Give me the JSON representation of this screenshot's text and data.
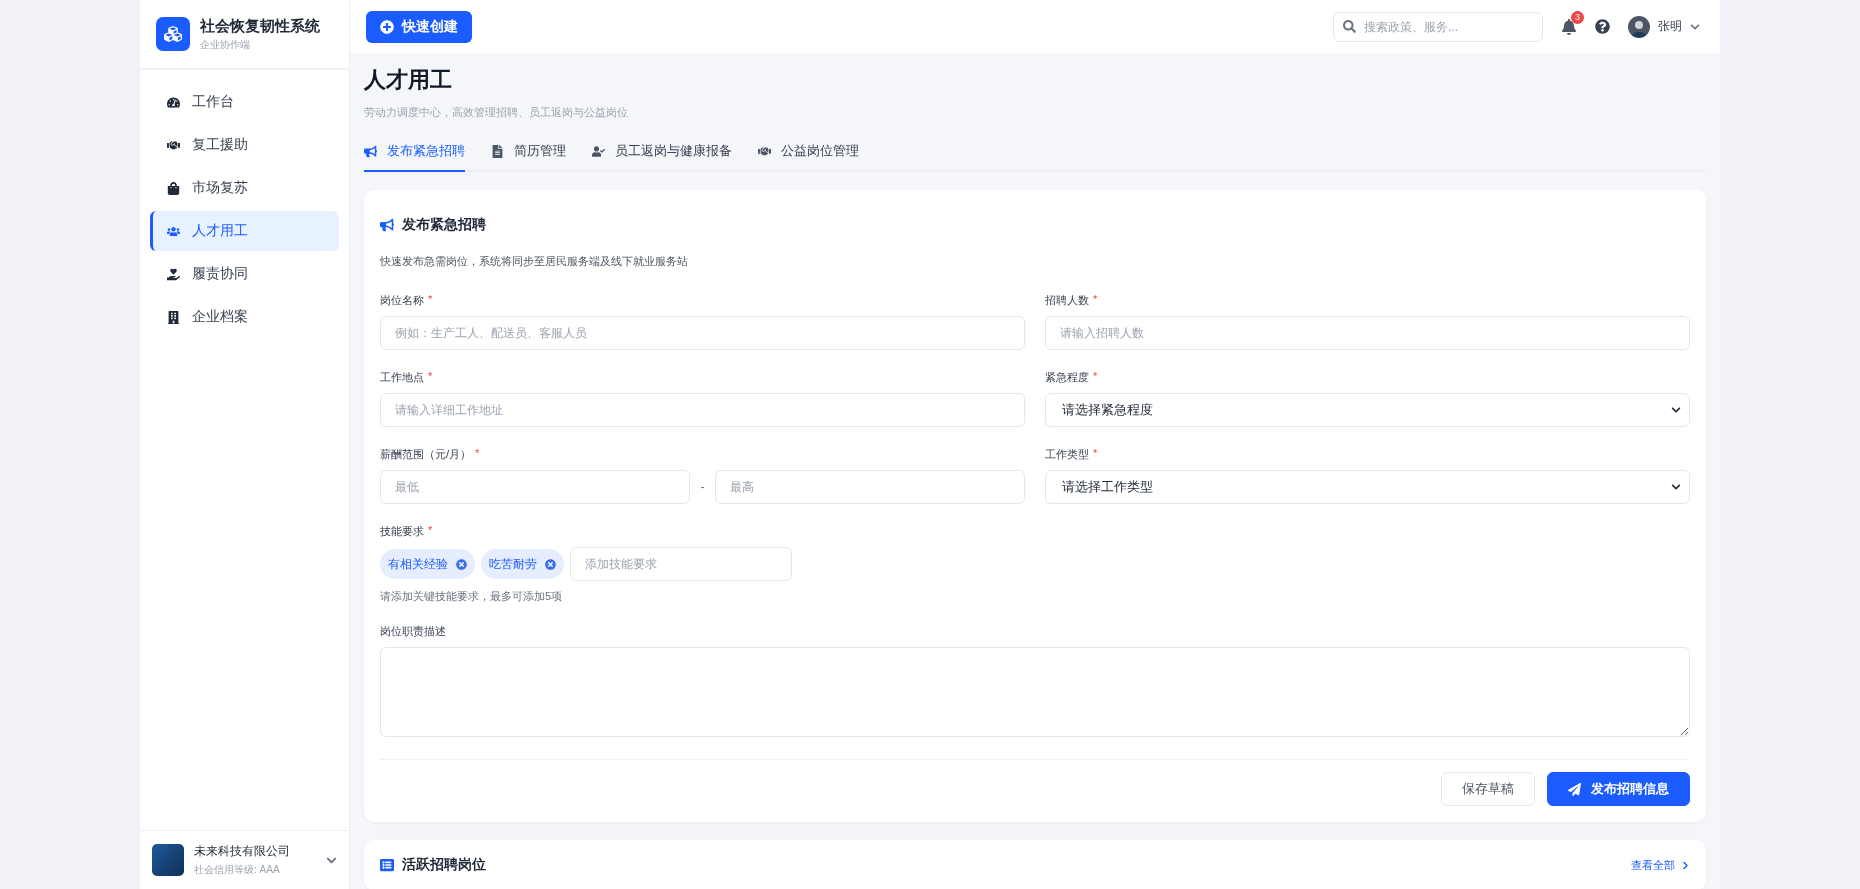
{
  "sidebar": {
    "brand": {
      "title": "社会恢复韧性系统",
      "subtitle": "企业协作端"
    },
    "items": [
      {
        "label": "工作台",
        "selected": false
      },
      {
        "label": "复工援助",
        "selected": false
      },
      {
        "label": "市场复苏",
        "selected": false
      },
      {
        "label": "人才用工",
        "selected": true
      },
      {
        "label": "履责协同",
        "selected": false
      },
      {
        "label": "企业档案",
        "selected": false
      }
    ],
    "company": {
      "name": "未来科技有限公司",
      "credit": "社会信用等级: AAA"
    }
  },
  "header": {
    "quick_create": "快速创建",
    "search": {
      "placeholder": "搜索政策、服务..."
    },
    "notification_count": "3",
    "user": "张明"
  },
  "page": {
    "title": "人才用工",
    "subtitle": "劳动力调度中心，高效管理招聘、员工返岗与公益岗位",
    "tabs": [
      {
        "label": "发布紧急招聘",
        "selected": true
      },
      {
        "label": "简历管理",
        "selected": false
      },
      {
        "label": "员工返岗与健康报备",
        "selected": false
      },
      {
        "label": "公益岗位管理",
        "selected": false
      }
    ]
  },
  "form": {
    "title": "发布紧急招聘",
    "description": "快速发布急需岗位，系统将同步至居民服务端及线下就业服务站",
    "fields": [
      {
        "kind": "text",
        "label": "岗位名称",
        "mark": "*",
        "placeholder": "例如：生产工人、配送员、客服人员"
      },
      {
        "kind": "text",
        "label": "招聘人数",
        "mark": "*",
        "placeholder": "请输入招聘人数"
      },
      {
        "kind": "text",
        "label": "工作地点",
        "mark": "*",
        "placeholder": "请输入详细工作地址"
      },
      {
        "kind": "select",
        "label": "紧急程度",
        "mark": "*",
        "value": "请选择紧急程度"
      },
      {
        "kind": "range",
        "label": "薪酬范围（元/月）",
        "mark": "*",
        "min_placeholder": "最低",
        "separator": "-",
        "max_placeholder": "最高"
      },
      {
        "kind": "select",
        "label": "工作类型",
        "mark": "*",
        "value": "请选择工作类型"
      },
      {
        "kind": "tags",
        "label": "技能要求",
        "mark": "*",
        "tags": [
          "有相关经验",
          "吃苦耐劳"
        ],
        "placeholder": "添加技能要求",
        "hint": "请添加关键技能要求，最多可添加5项"
      },
      {
        "kind": "textarea",
        "label": "岗位职责描述"
      }
    ],
    "buttons": {
      "save": "保存草稿",
      "publish": "发布招聘信息"
    }
  },
  "active_jobs": {
    "title": "活跃招聘岗位",
    "link": "查看全部"
  }
}
